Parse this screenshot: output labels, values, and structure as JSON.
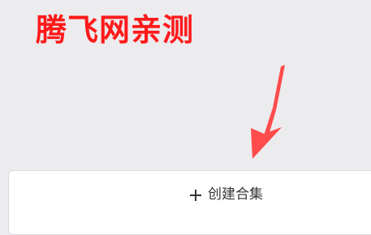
{
  "watermark": {
    "text": "腾飞网亲测"
  },
  "collection": {
    "create_label": "创建合集",
    "plus_icon": "plus-icon"
  },
  "colors": {
    "background": "#ecebee",
    "watermark": "#ff1a1a",
    "arrow": "#ff4b4b",
    "card": "#ffffff",
    "text": "#333333"
  }
}
